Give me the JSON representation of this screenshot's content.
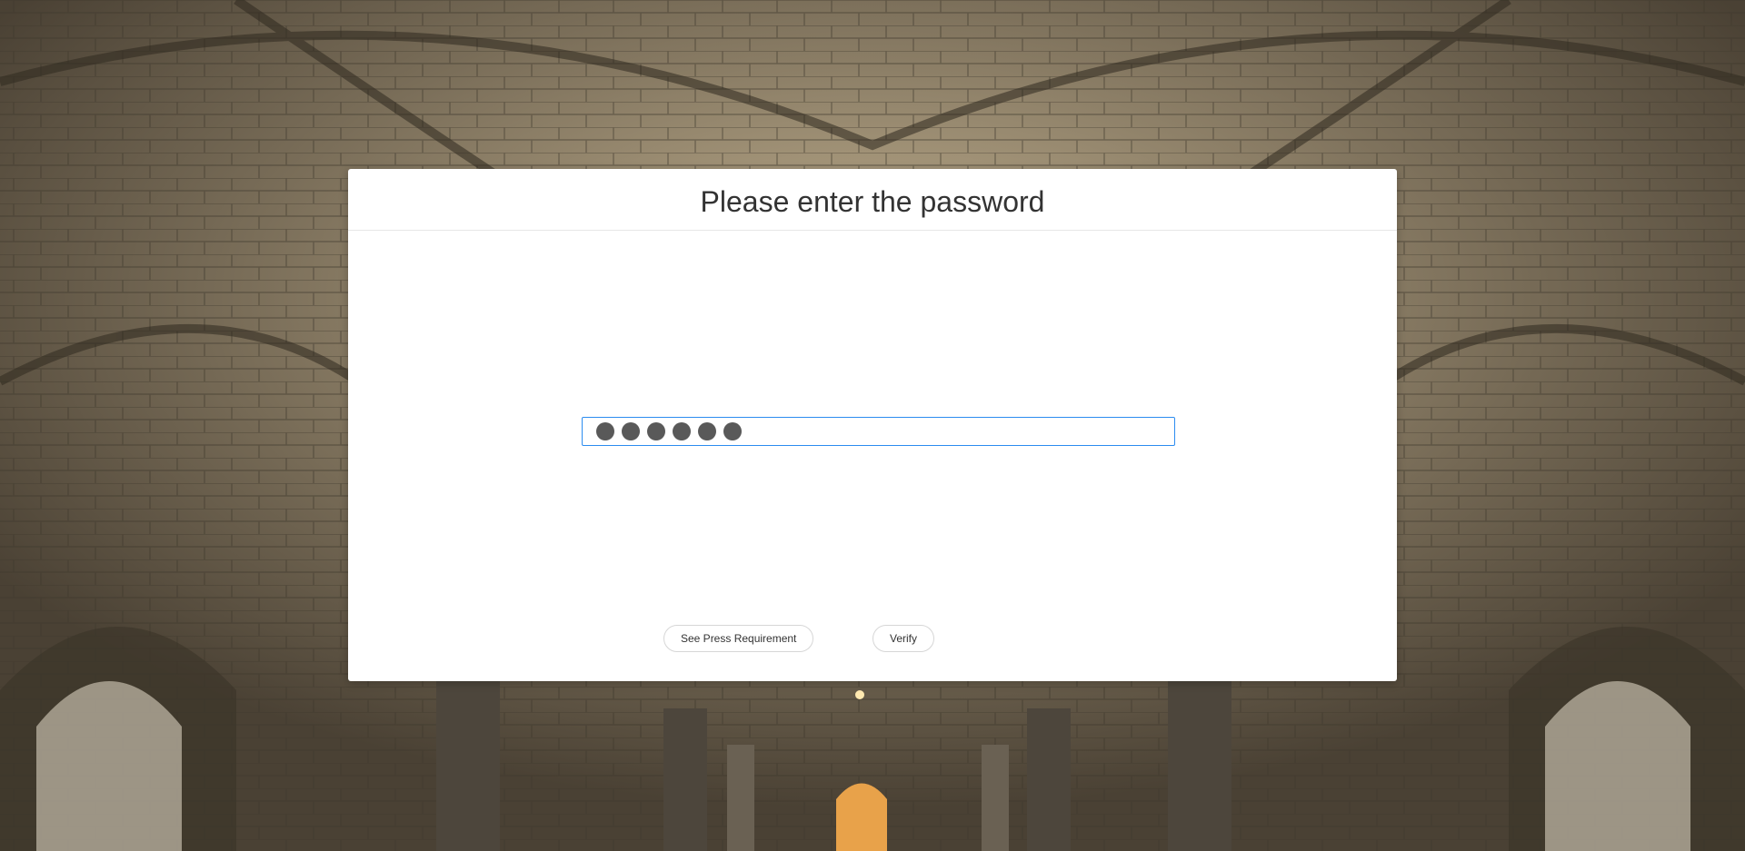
{
  "dialog": {
    "title": "Please enter the password"
  },
  "password_field": {
    "masked_char_count": 6,
    "value_masked": "●●●●●●"
  },
  "actions": {
    "requirement_label": "See Press Requirement",
    "verify_label": "Verify"
  },
  "colors": {
    "focus_border": "#2b8cf0",
    "mask_dot": "#595959",
    "dialog_bg": "#ffffff"
  }
}
